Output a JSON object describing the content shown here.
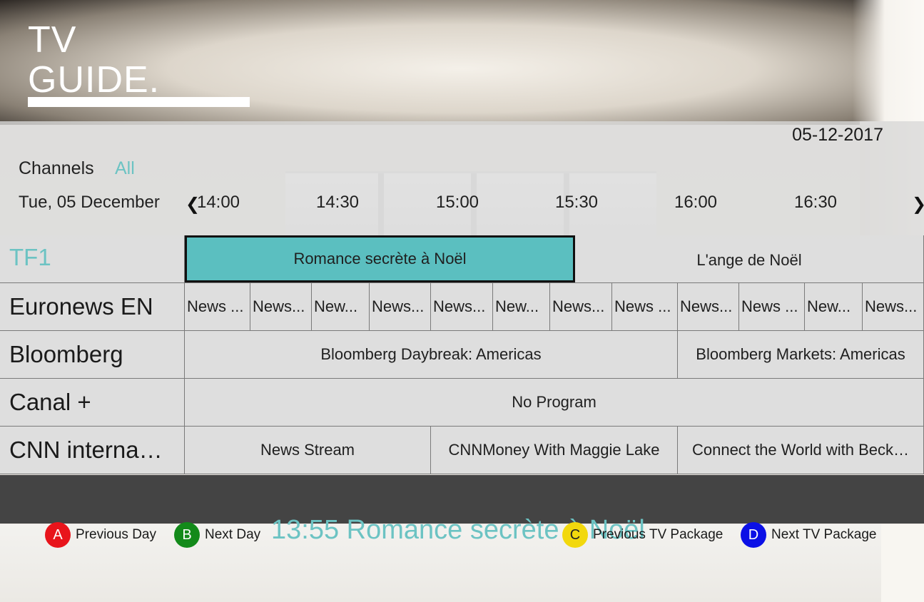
{
  "app": {
    "title_line1": "TV",
    "title_line2": "GUIDE."
  },
  "header": {
    "date": "05-12-2017",
    "channels_label": "Channels",
    "channels_filter": "All",
    "day_label": "Tue, 05 December",
    "times": [
      "14:00",
      "14:30",
      "15:00",
      "15:30",
      "16:00",
      "16:30"
    ],
    "prev_icon": "chevron-left-icon",
    "next_icon": "chevron-right-icon"
  },
  "channels": [
    {
      "name": "TF1",
      "programs": [
        {
          "title": "Romance secrète à Noël",
          "selected": true
        },
        {
          "title": "L'ange de Noël"
        }
      ]
    },
    {
      "name": "Euronews EN",
      "programs": [
        {
          "title": "News ..."
        },
        {
          "title": "News..."
        },
        {
          "title": "New..."
        },
        {
          "title": "News..."
        },
        {
          "title": "News..."
        },
        {
          "title": "New..."
        },
        {
          "title": "News..."
        },
        {
          "title": "News ..."
        },
        {
          "title": "News..."
        },
        {
          "title": "News ..."
        },
        {
          "title": "New..."
        },
        {
          "title": "News..."
        }
      ]
    },
    {
      "name": "Bloomberg",
      "programs": [
        {
          "title": "Bloomberg Daybreak: Americas"
        },
        {
          "title": "Bloomberg Markets: Americas"
        }
      ]
    },
    {
      "name": "Canal +",
      "programs": [
        {
          "title": "No Program"
        }
      ]
    },
    {
      "name": "CNN interna…",
      "programs": [
        {
          "title": "News Stream"
        },
        {
          "title": "CNNMoney With Maggie Lake"
        },
        {
          "title": "Connect the World with Beck…"
        }
      ]
    }
  ],
  "now_playing": "13:55 Romance secrète à Noël",
  "legend": [
    {
      "key": "A",
      "label": "Previous Day",
      "color": "#e8141b"
    },
    {
      "key": "B",
      "label": "Next Day",
      "color": "#138a1a"
    },
    {
      "key": "C",
      "label": "Previous TV Package",
      "color": "#f2d80d"
    },
    {
      "key": "D",
      "label": "Next TV Package",
      "color": "#0b10e6"
    }
  ],
  "colors": {
    "accent": "#6cc3c3",
    "selected_program": "#5bbfc0",
    "detail_bar": "#444444"
  }
}
